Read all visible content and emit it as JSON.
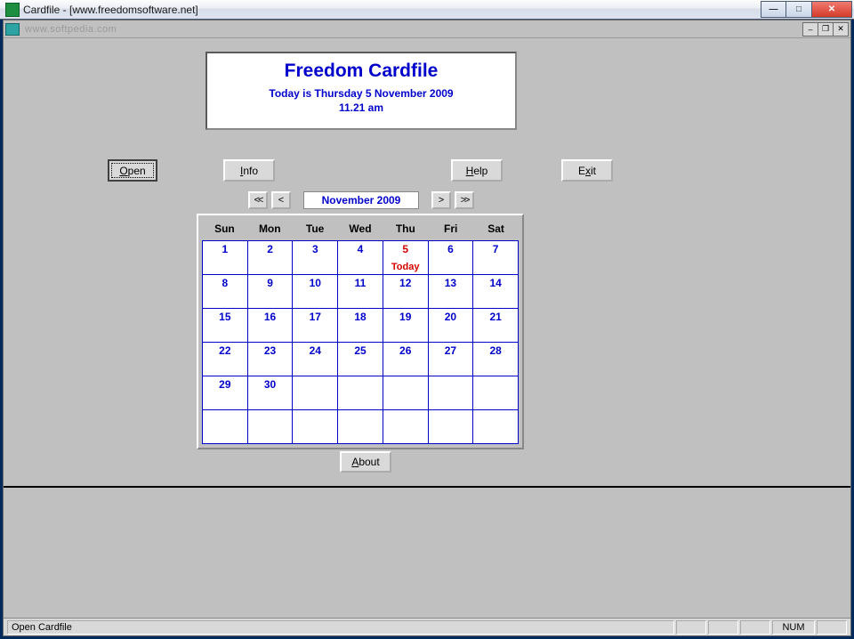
{
  "window": {
    "title": "Cardfile - [www.freedomsoftware.net]",
    "watermark": "www.softpedia.com"
  },
  "header": {
    "title": "Freedom Cardfile",
    "date_line": "Today is Thursday 5 November 2009",
    "time_line": "11.21 am"
  },
  "buttons": {
    "open": "Open",
    "info": "Info",
    "help": "Help",
    "exit": "Exit",
    "about": "About"
  },
  "nav": {
    "first": "<<",
    "prev": "<",
    "month_label": "November 2009",
    "next": ">",
    "last": ">>"
  },
  "calendar": {
    "day_headers": [
      "Sun",
      "Mon",
      "Tue",
      "Wed",
      "Thu",
      "Fri",
      "Sat"
    ],
    "today_day": 5,
    "today_label": "Today",
    "weeks": [
      [
        1,
        2,
        3,
        4,
        5,
        6,
        7
      ],
      [
        8,
        9,
        10,
        11,
        12,
        13,
        14
      ],
      [
        15,
        16,
        17,
        18,
        19,
        20,
        21
      ],
      [
        22,
        23,
        24,
        25,
        26,
        27,
        28
      ],
      [
        29,
        30,
        null,
        null,
        null,
        null,
        null
      ],
      [
        null,
        null,
        null,
        null,
        null,
        null,
        null
      ]
    ]
  },
  "statusbar": {
    "message": "Open Cardfile",
    "num": "NUM"
  }
}
